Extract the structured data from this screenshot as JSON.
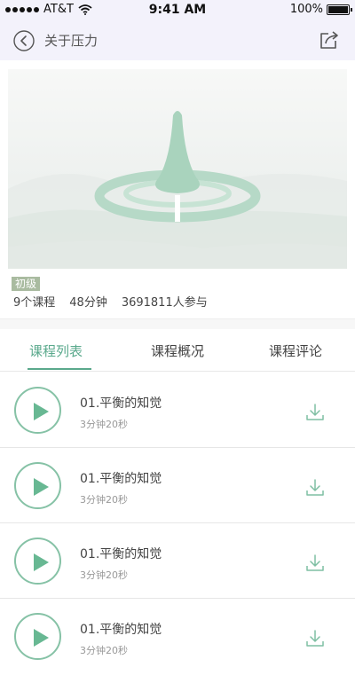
{
  "status_bar": {
    "carrier": "AT&T",
    "time": "9:41 AM",
    "battery": "100%"
  },
  "nav": {
    "title": "关于压力",
    "back_icon": "chevron-left-circle-icon",
    "share_icon": "share-icon"
  },
  "course": {
    "level": "初级",
    "lessons": "9个课程",
    "duration": "48分钟",
    "participants": "3691811人参与"
  },
  "tabs": [
    {
      "label": "课程列表",
      "active": true
    },
    {
      "label": "课程概况",
      "active": false
    },
    {
      "label": "课程评论",
      "active": false
    }
  ],
  "lessons": [
    {
      "title": "01.平衡的知觉",
      "duration": "3分钟20秒"
    },
    {
      "title": "01.平衡的知觉",
      "duration": "3分钟20秒"
    },
    {
      "title": "01.平衡的知觉",
      "duration": "3分钟20秒"
    },
    {
      "title": "01.平衡的知觉",
      "duration": "3分钟20秒"
    }
  ],
  "colors": {
    "accent": "#5aa98c",
    "badge": "#a9bba0",
    "nav_bg": "#f3f2fb"
  }
}
